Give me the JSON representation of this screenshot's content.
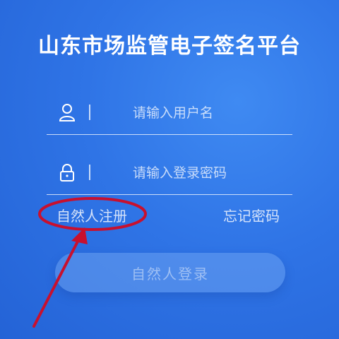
{
  "app": {
    "title": "山东市场监管电子签名平台"
  },
  "form": {
    "username": {
      "placeholder": "请输入用户名",
      "value": "",
      "icon": "user-icon"
    },
    "password": {
      "placeholder": "请输入登录密码",
      "value": "",
      "icon": "lock-icon"
    },
    "register_label": "自然人注册",
    "forgot_label": "忘记密码",
    "login_label": "自然人登录"
  },
  "colors": {
    "background": "#2f74e6",
    "annotation": "#c8102e",
    "text": "#ffffff"
  }
}
